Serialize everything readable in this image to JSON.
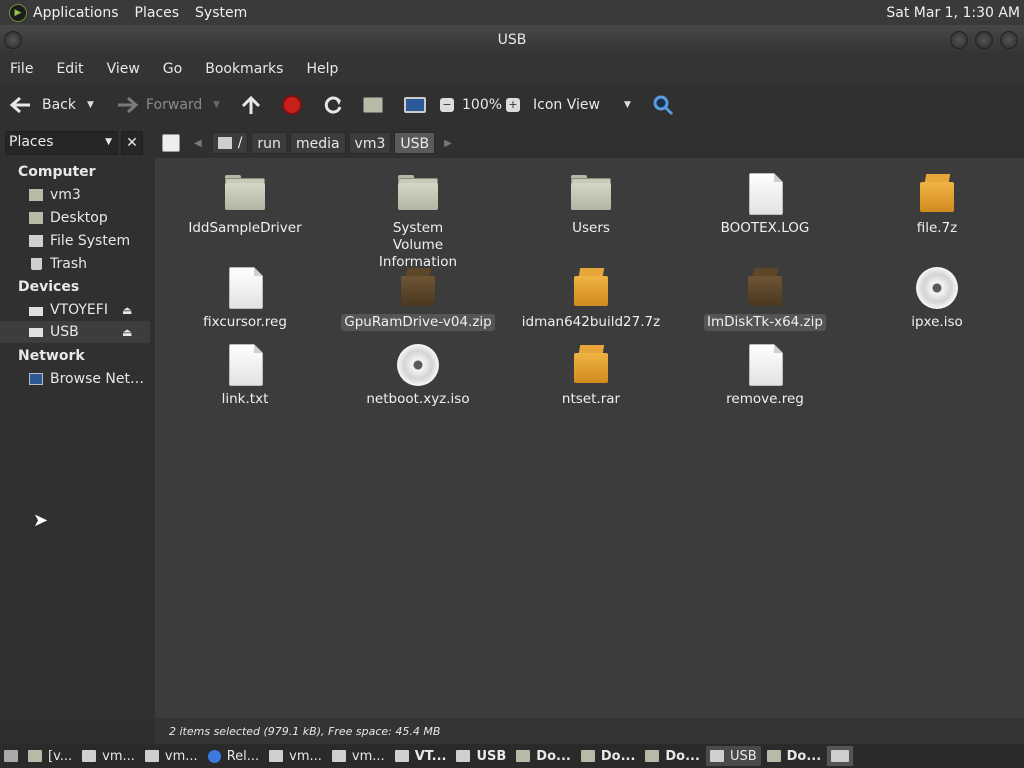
{
  "topbar": {
    "menus": [
      "Applications",
      "Places",
      "System"
    ],
    "clock": "Sat Mar  1,  1:30 AM"
  },
  "window": {
    "title": "USB"
  },
  "menubar": [
    "File",
    "Edit",
    "View",
    "Go",
    "Bookmarks",
    "Help"
  ],
  "toolbar": {
    "back": "Back",
    "forward": "Forward",
    "zoom": "100%",
    "view": "Icon View"
  },
  "sidebar": {
    "select": "Places",
    "close": "✕",
    "sections": {
      "computer": "Computer",
      "devices": "Devices",
      "network": "Network"
    },
    "computer_items": [
      "vm3",
      "Desktop",
      "File System",
      "Trash"
    ],
    "device_items": [
      "VTOYEFI",
      "USB"
    ],
    "network_items": [
      "Browse Net…"
    ]
  },
  "pathbar": [
    "/",
    "run",
    "media",
    "vm3",
    "USB"
  ],
  "files": [
    {
      "name": "IddSampleDriver",
      "type": "folder"
    },
    {
      "name": "System Volume Information",
      "type": "folder"
    },
    {
      "name": "Users",
      "type": "folder"
    },
    {
      "name": "BOOTEX.LOG",
      "type": "document"
    },
    {
      "name": "file.7z",
      "type": "archive"
    },
    {
      "name": "fixcursor.reg",
      "type": "document"
    },
    {
      "name": "GpuRamDrive-v04.zip",
      "type": "archive-selected"
    },
    {
      "name": "idman642build27.7z",
      "type": "archive"
    },
    {
      "name": "ImDiskTk-x64.zip",
      "type": "archive-selected"
    },
    {
      "name": "ipxe.iso",
      "type": "disc"
    },
    {
      "name": "link.txt",
      "type": "document"
    },
    {
      "name": "netboot.xyz.iso",
      "type": "disc"
    },
    {
      "name": "ntset.rar",
      "type": "archive"
    },
    {
      "name": "remove.reg",
      "type": "document"
    }
  ],
  "status": "2 items selected (979.1 kB), Free space: 45.4 MB",
  "taskbar": [
    "[v...",
    "vm...",
    "vm...",
    "Rel...",
    "vm...",
    "vm...",
    "VT...",
    "USB",
    "Do...",
    "Do...",
    "Do...",
    "USB",
    "Do..."
  ]
}
